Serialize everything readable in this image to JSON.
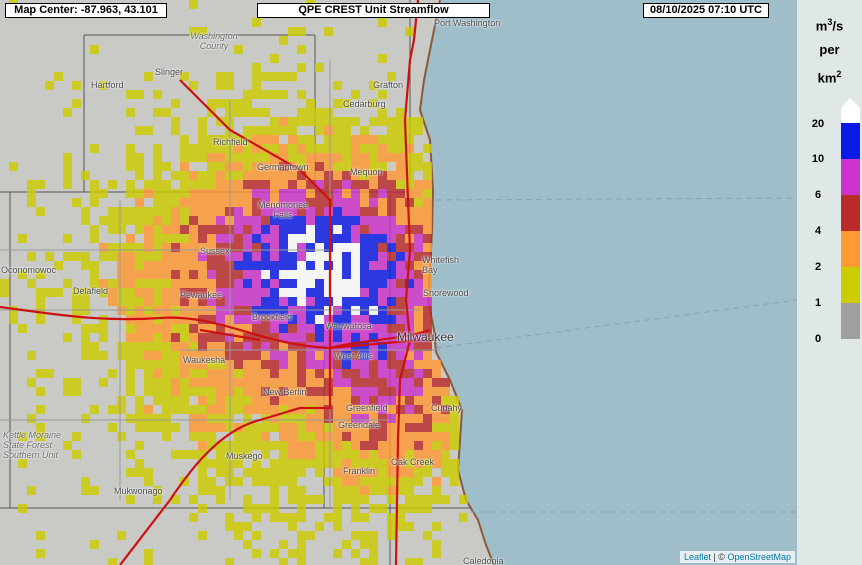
{
  "header": {
    "center": "Map Center: -87.963, 43.101",
    "title": "QPE CREST Unit Streamflow",
    "time": "08/10/2025   07:10 UTC"
  },
  "legend": {
    "unit_top": "m",
    "unit_sup": "3",
    "unit_rest": "/s",
    "unit_per": "per",
    "unit_km": "km",
    "unit_km_sup": "2",
    "bins": [
      {
        "label": "0",
        "color": "#a0a0a0"
      },
      {
        "label": "1",
        "color": "#cccc00"
      },
      {
        "label": "2",
        "color": "#ff9933"
      },
      {
        "label": "4",
        "color": "#bb2a2a"
      },
      {
        "label": "6",
        "color": "#cc33cc"
      },
      {
        "label": "10",
        "color": "#0a1ae6"
      },
      {
        "label": "20",
        "color": "#ffffff"
      }
    ]
  },
  "places": [
    {
      "name": "Port Washington"
    },
    {
      "name": "Washington County"
    },
    {
      "name": "Hartford"
    },
    {
      "name": "Slinger"
    },
    {
      "name": "Grafton"
    },
    {
      "name": "Cedarburg"
    },
    {
      "name": "Richfield"
    },
    {
      "name": "Germantown"
    },
    {
      "name": "Mequon"
    },
    {
      "name": "Menomonee Falls"
    },
    {
      "name": "Sussex"
    },
    {
      "name": "Whitefish Bay"
    },
    {
      "name": "Oconomowoc"
    },
    {
      "name": "Delafield"
    },
    {
      "name": "Pewaukee"
    },
    {
      "name": "Shorewood"
    },
    {
      "name": "Brookfield"
    },
    {
      "name": "Wauwatosa"
    },
    {
      "name": "Milwaukee"
    },
    {
      "name": "Waukesha"
    },
    {
      "name": "West Allis"
    },
    {
      "name": "New Berlin"
    },
    {
      "name": "Greenfield"
    },
    {
      "name": "Cudahy"
    },
    {
      "name": "Greendale"
    },
    {
      "name": "Kettle Moraine State Forest Southern Unit"
    },
    {
      "name": "Muskego"
    },
    {
      "name": "Franklin"
    },
    {
      "name": "Oak Creek"
    },
    {
      "name": "Mukwonago"
    },
    {
      "name": "Caledonia"
    }
  ],
  "attribution": {
    "leaflet": "Leaflet",
    "sep": " | © ",
    "osm": "OpenStreetMap"
  },
  "colors": {
    "lake": "#9fbec9",
    "land": "#c9c9c6",
    "highway": "#cc1111",
    "legend_bg": "#dfe8e6"
  }
}
